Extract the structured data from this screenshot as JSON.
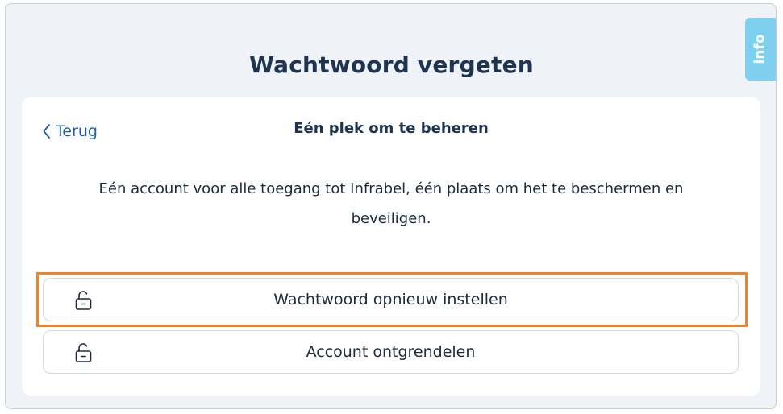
{
  "page": {
    "title": "Wachtwoord vergeten"
  },
  "info_tab": {
    "label": "info"
  },
  "card": {
    "back_label": "Terug",
    "heading": "Eén plek om te beheren",
    "description": "Eén account voor alle toegang tot Infrabel, één plaats om het te beschermen en beveiligen."
  },
  "options": [
    {
      "label": "Wachtwoord opnieuw instellen",
      "icon": "unlock-icon"
    },
    {
      "label": "Account ontgrendelen",
      "icon": "unlock-icon"
    }
  ],
  "colors": {
    "title": "#1e3450",
    "link": "#1f5da5",
    "info_tab": "#7fcfee",
    "highlight": "#f0842c",
    "background": "#eff3f7"
  }
}
